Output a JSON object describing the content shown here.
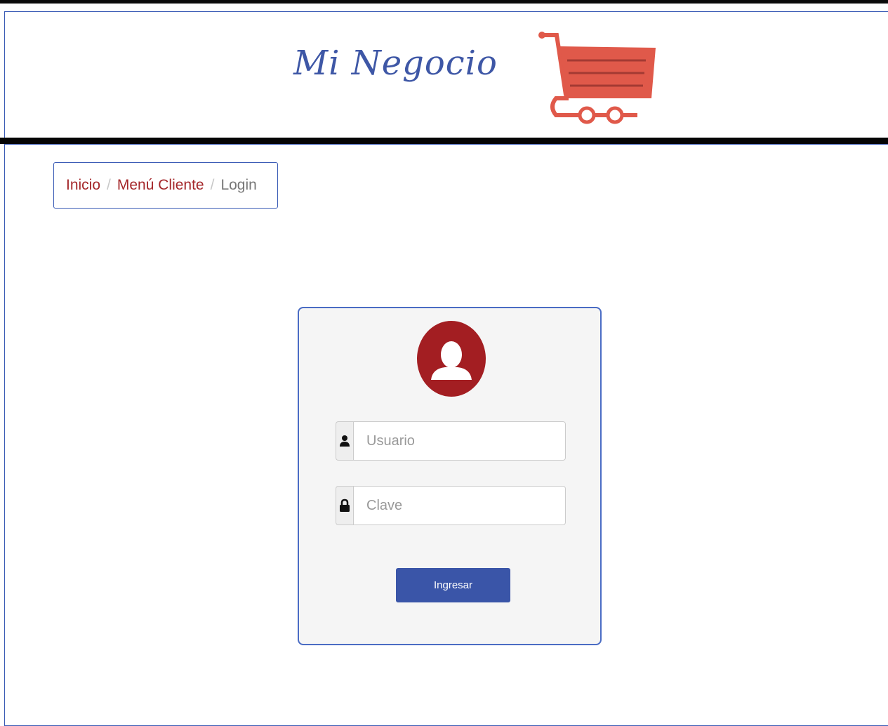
{
  "brand": {
    "title": "Mi Negocio",
    "logo_icon": "shopping-cart-icon",
    "accent_color": "#e0594a"
  },
  "breadcrumb": {
    "items": [
      "Inicio",
      "Menú Cliente"
    ],
    "current": "Login"
  },
  "login": {
    "avatar_icon": "user-avatar-icon",
    "username": {
      "icon": "user-icon",
      "placeholder": "Usuario",
      "value": ""
    },
    "password": {
      "icon": "lock-icon",
      "placeholder": "Clave",
      "value": ""
    },
    "submit_label": "Ingresar"
  },
  "colors": {
    "primary": "#3a55a8",
    "danger": "#a31e22",
    "link": "#a4272a"
  }
}
